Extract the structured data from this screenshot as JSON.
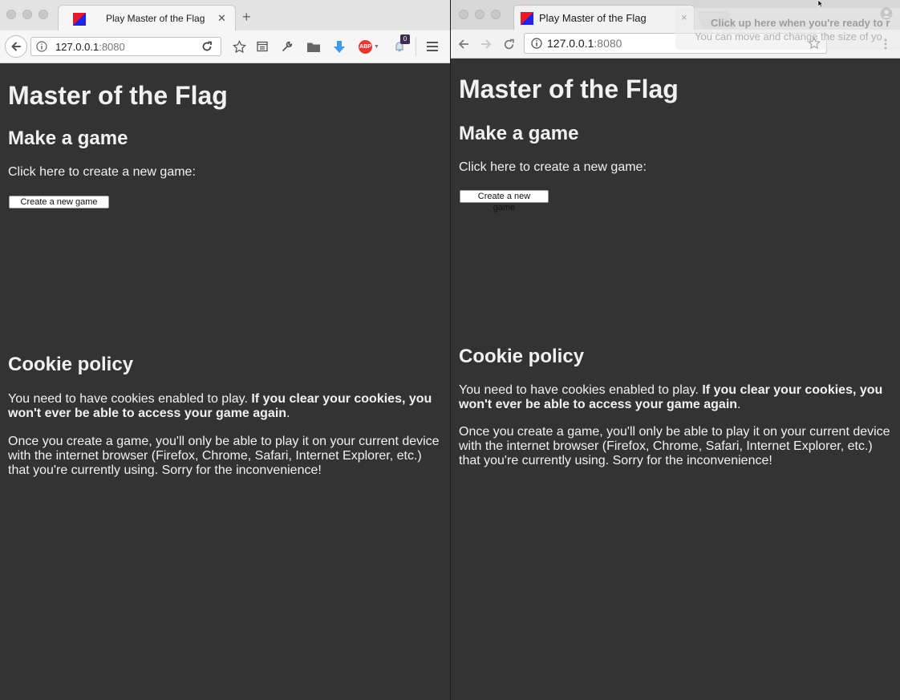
{
  "windows": {
    "left": {
      "tab_title": "Play Master of the Flag",
      "url_host": "127.0.0.1",
      "url_port": ":8080",
      "notification_count": "0",
      "adblock_label": "ABP"
    },
    "right": {
      "tab_title": "Play Master of the Flag",
      "url_host": "127.0.0.1",
      "url_port": ":8080",
      "tab_close": "×"
    }
  },
  "overlay_hint": {
    "line1": "Click up here when you're ready to r",
    "line2": "You can move and change the size of yo"
  },
  "page": {
    "title": "Master of the Flag",
    "make_game_heading": "Make a game",
    "make_game_text": "Click here to create a new game:",
    "create_button_label": "Create a new game",
    "cookie_heading": "Cookie policy",
    "cookie_p1_normal": "You need to have cookies enabled to play. ",
    "cookie_p1_bold": "If you clear your cookies, you won't ever be able to access your game again",
    "cookie_p1_end": ".",
    "cookie_p2": "Once you create a game, you'll only be able to play it on your current device with the internet browser (Firefox, Chrome, Safari, Internet Explorer, etc.) that you're currently using. Sorry for the inconvenience!"
  },
  "colors": {
    "page_background": "#333333",
    "page_text": "#f1f1f1",
    "favicon_red": "#e8182b",
    "favicon_blue": "#2323e6",
    "adblock_red": "#e53935",
    "download_blue": "#3d9be9"
  },
  "icons": [
    "back-icon",
    "forward-icon",
    "info-icon",
    "reload-icon",
    "star-icon",
    "reading-list-icon",
    "wrench-icon",
    "folder-icon",
    "download-icon",
    "adblock-icon",
    "notification-icon",
    "menu-icon",
    "profile-icon",
    "close-icon",
    "new-tab-icon"
  ]
}
